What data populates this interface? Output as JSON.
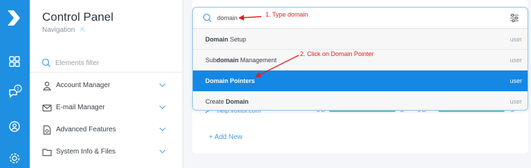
{
  "sidebar": {
    "title": "Control Panel",
    "subtitle": "Navigation",
    "filter_placeholder": "Elements filter",
    "items": [
      {
        "label": "Account Manager"
      },
      {
        "label": "E-mail Manager"
      },
      {
        "label": "Advanced Features"
      },
      {
        "label": "System Info & Files"
      }
    ]
  },
  "rail": {
    "notification_count": "1"
  },
  "search": {
    "query": "domain",
    "results": [
      {
        "pre": "",
        "match": "Domain",
        "post": " Setup",
        "role": "user"
      },
      {
        "pre": "Sub",
        "match": "domain",
        "post": " Management",
        "role": "user"
      },
      {
        "pre": "",
        "match": "Domain",
        "post": " Pointers",
        "role": "user"
      },
      {
        "pre": "Create ",
        "match": "Domain",
        "post": "",
        "role": "user"
      }
    ]
  },
  "background": {
    "row_link": "help.voxtor.com",
    "row_val_1": "0 B",
    "row_val_2": "0 B",
    "row_pct_1": "5/",
    "row_pct_2": "5/",
    "add_new": "+ Add New"
  },
  "annotations": {
    "step1": "1. Type domain",
    "step2": "2. Click on Domain Pointer"
  },
  "colors": {
    "rail": "#1e8fe1",
    "active_result": "#1488e4",
    "annotation": "#e02020"
  }
}
